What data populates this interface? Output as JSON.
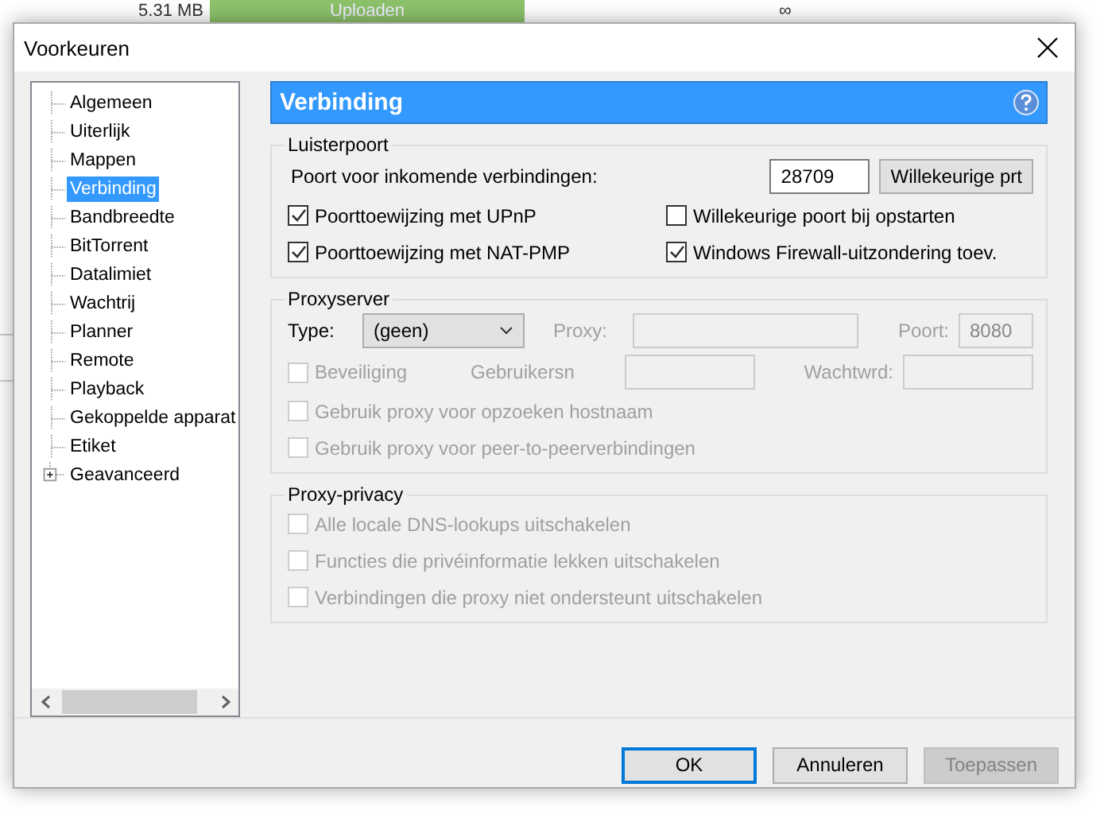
{
  "background_app": {
    "size": "5.31 MB",
    "status": "Uploaden",
    "level": 1,
    "column_3": "∞"
  },
  "window": {
    "title": "Voorkeuren"
  },
  "sidebar": {
    "items": [
      {
        "label": "Algemeen",
        "selected": false,
        "kind": "leaf"
      },
      {
        "label": "Uiterlijk",
        "selected": false,
        "kind": "leaf"
      },
      {
        "label": "Mappen",
        "selected": false,
        "kind": "leaf"
      },
      {
        "label": "Verbinding",
        "selected": true,
        "kind": "leaf"
      },
      {
        "label": "Bandbreedte",
        "selected": false,
        "kind": "leaf"
      },
      {
        "label": "BitTorrent",
        "selected": false,
        "kind": "leaf"
      },
      {
        "label": "Datalimiet",
        "selected": false,
        "kind": "leaf"
      },
      {
        "label": "Wachtrij",
        "selected": false,
        "kind": "leaf"
      },
      {
        "label": "Planner",
        "selected": false,
        "kind": "leaf"
      },
      {
        "label": "Remote",
        "selected": false,
        "kind": "leaf"
      },
      {
        "label": "Playback",
        "selected": false,
        "kind": "leaf"
      },
      {
        "label": "Gekoppelde apparat",
        "selected": false,
        "kind": "leaf"
      },
      {
        "label": "Etiket",
        "selected": false,
        "kind": "leaf"
      },
      {
        "label": "Geavanceerd",
        "selected": false,
        "kind": "group",
        "expanded": false
      }
    ]
  },
  "panel": {
    "title": "Verbinding",
    "listening_port": {
      "title": "Luisterpoort",
      "port_label": "Poort voor inkomende verbindingen:",
      "port_value": "28709",
      "random_button": "Willekeurige prt",
      "options": [
        {
          "label": "Poorttoewijzing met UPnP",
          "checked": true,
          "disabled": false
        },
        {
          "label": "Willekeurige poort bij opstarten",
          "checked": false,
          "disabled": false
        },
        {
          "label": "Poorttoewijzing met NAT-PMP",
          "checked": true,
          "disabled": false
        },
        {
          "label": "Windows Firewall-uitzondering toev.",
          "checked": true,
          "disabled": false
        }
      ]
    },
    "proxy_server": {
      "title": "Proxyserver",
      "type_label": "Type:",
      "type_value": "(geen)",
      "proxy_label": "Proxy:",
      "port_label": "Poort:",
      "port_value": "8080",
      "fields_disabled": true,
      "auth": {
        "label": "Beveiliging",
        "checked": false,
        "disabled": true
      },
      "username_label": "Gebruikersn",
      "password_label": "Wachtwrd:",
      "options": [
        {
          "label": "Gebruik proxy voor opzoeken hostnaam",
          "checked": false,
          "disabled": true
        },
        {
          "label": "Gebruik proxy voor peer-to-peerverbindingen",
          "checked": false,
          "disabled": true
        }
      ]
    },
    "proxy_privacy": {
      "title": "Proxy-privacy",
      "options": [
        {
          "label": "Alle locale DNS-lookups uitschakelen",
          "checked": false,
          "disabled": true
        },
        {
          "label": "Functies die privéinformatie lekken uitschakelen",
          "checked": false,
          "disabled": true
        },
        {
          "label": "Verbindingen die proxy niet ondersteunt uitschakelen",
          "checked": false,
          "disabled": true
        }
      ]
    }
  },
  "buttons": [
    {
      "label": "OK",
      "kind": "default",
      "disabled": false
    },
    {
      "label": "Annuleren",
      "kind": "normal",
      "disabled": false
    },
    {
      "label": "Toepassen",
      "kind": "normal",
      "disabled": true
    }
  ]
}
